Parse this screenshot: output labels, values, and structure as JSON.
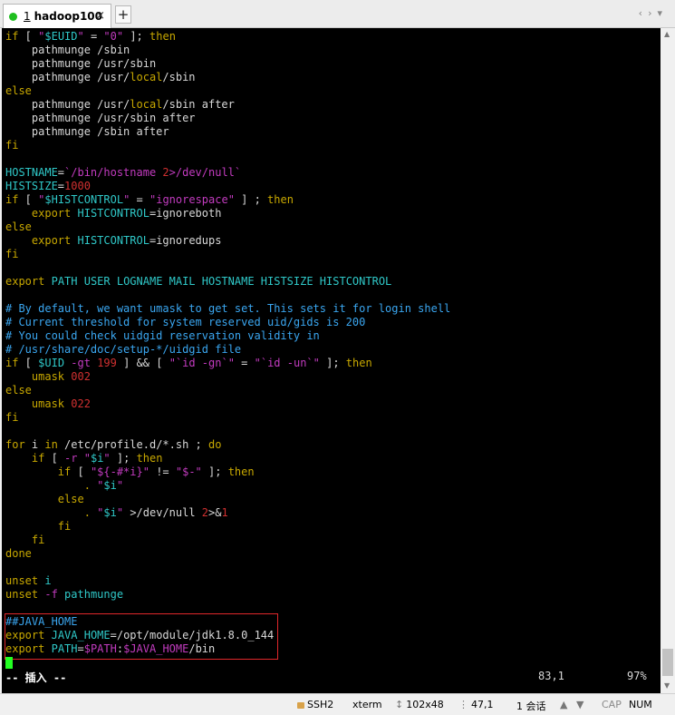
{
  "tab": {
    "number": "1",
    "title": "hadoop100",
    "close": "×"
  },
  "tabbar": {
    "add": "+",
    "nav_left": "‹",
    "nav_right": "›",
    "menu": "▾"
  },
  "terminal": {
    "mode": "-- 插入 --",
    "position": "83,1",
    "percent": "97%"
  },
  "statusbar": {
    "protocol": "SSH2",
    "term": "xterm",
    "size": "102x48",
    "cursor": "47,1",
    "sessions": "1 会话",
    "up": "▲",
    "down": "▼",
    "caps": "CAP",
    "num": "NUM"
  },
  "colors": {
    "keyword": "#c8a800",
    "string": "#c23bbf",
    "number": "#d03030",
    "comment": "#3aa6f0",
    "variable": "#2fc8c8",
    "highlight_box": "#e0272b",
    "cursor": "#22ff22"
  }
}
